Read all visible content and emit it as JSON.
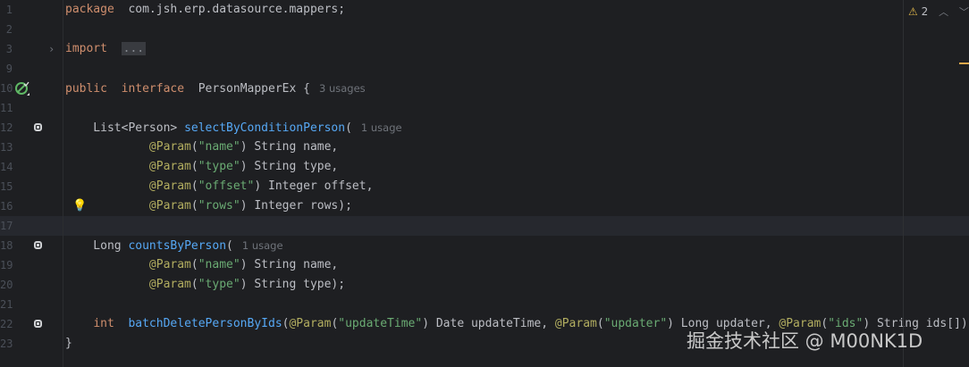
{
  "editor": {
    "warnings_count": "2",
    "watermark": "掘金技术社区 @ M00NK1D",
    "lines": [
      {
        "num": "1",
        "parts": [
          [
            "kw",
            "package"
          ],
          [
            "",
            "com.jsh.erp.datasource.mappers;"
          ]
        ]
      },
      {
        "num": "2",
        "parts": []
      },
      {
        "num": "3",
        "parts": [
          [
            "kw",
            "import"
          ],
          [
            "fold",
            "..."
          ]
        ]
      },
      {
        "num": "9",
        "parts": []
      },
      {
        "num": "10",
        "parts": [
          [
            "kw",
            "public"
          ],
          [
            "kw",
            "interface"
          ],
          [
            "",
            "PersonMapperEx {"
          ],
          [
            "hint",
            "3 usages"
          ]
        ]
      },
      {
        "num": "11",
        "parts": []
      },
      {
        "num": "12",
        "parts": [
          [
            "",
            "    List<Person>"
          ],
          [
            "fn",
            "selectByConditionPerson"
          ],
          [
            "",
            "("
          ],
          [
            "hint",
            "1 usage"
          ]
        ]
      },
      {
        "num": "13",
        "parts": [
          [
            "",
            "            "
          ],
          [
            "ann",
            "@Param"
          ],
          [
            "",
            "("
          ],
          [
            "str",
            "\"name\""
          ],
          [
            "",
            ") String name,"
          ]
        ]
      },
      {
        "num": "14",
        "parts": [
          [
            "",
            "            "
          ],
          [
            "ann",
            "@Param"
          ],
          [
            "",
            "("
          ],
          [
            "str",
            "\"type\""
          ],
          [
            "",
            ") String type,"
          ]
        ]
      },
      {
        "num": "15",
        "parts": [
          [
            "",
            "            "
          ],
          [
            "ann",
            "@Param"
          ],
          [
            "",
            "("
          ],
          [
            "str",
            "\"offset\""
          ],
          [
            "",
            ") Integer offset,"
          ]
        ]
      },
      {
        "num": "16",
        "parts": [
          [
            "",
            "            "
          ],
          [
            "ann",
            "@Param"
          ],
          [
            "",
            "("
          ],
          [
            "str",
            "\"rows\""
          ],
          [
            "",
            ") Integer rows);"
          ]
        ]
      },
      {
        "num": "17",
        "parts": []
      },
      {
        "num": "18",
        "parts": [
          [
            "",
            "    Long"
          ],
          [
            "fn",
            "countsByPerson"
          ],
          [
            "",
            "("
          ],
          [
            "hint",
            "1 usage"
          ]
        ]
      },
      {
        "num": "19",
        "parts": [
          [
            "",
            "            "
          ],
          [
            "ann",
            "@Param"
          ],
          [
            "",
            "("
          ],
          [
            "str",
            "\"name\""
          ],
          [
            "",
            ") String name,"
          ]
        ]
      },
      {
        "num": "20",
        "parts": [
          [
            "",
            "            "
          ],
          [
            "ann",
            "@Param"
          ],
          [
            "",
            "("
          ],
          [
            "str",
            "\"type\""
          ],
          [
            "",
            ") String type);"
          ]
        ]
      },
      {
        "num": "21",
        "parts": []
      },
      {
        "num": "22",
        "parts": [
          [
            "",
            "    "
          ],
          [
            "kw",
            "int"
          ],
          [
            "fn",
            "batchDeletePersonByIds"
          ],
          [
            "",
            "("
          ],
          [
            "ann",
            "@Param"
          ],
          [
            "",
            "("
          ],
          [
            "str",
            "\"updateTime\""
          ],
          [
            "",
            ") Date updateTime, "
          ],
          [
            "ann",
            "@Param"
          ],
          [
            "",
            "("
          ],
          [
            "str",
            "\"updater\""
          ],
          [
            "",
            ") Long updater, "
          ],
          [
            "ann",
            "@Param"
          ],
          [
            "",
            "("
          ],
          [
            "str",
            "\"ids\""
          ],
          [
            "",
            ") String ids[]);"
          ]
        ]
      },
      {
        "num": "23",
        "parts": [
          [
            "",
            "}"
          ]
        ]
      }
    ]
  }
}
